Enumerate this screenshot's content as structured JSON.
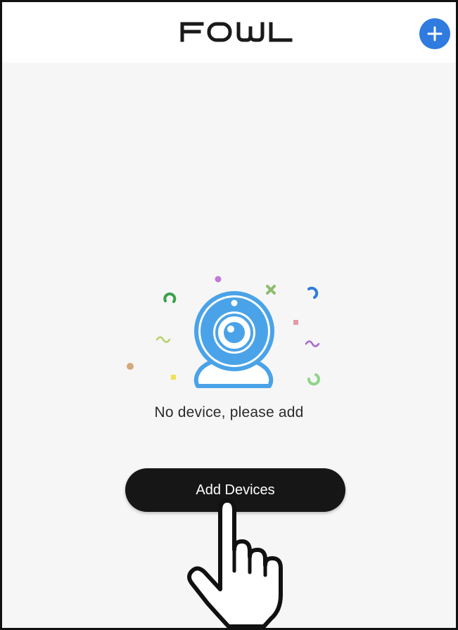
{
  "header": {
    "logo_text": "FOWL",
    "add_button_label": "+"
  },
  "empty_state": {
    "illustration_icon": "webcam-icon",
    "message": "No device, please add"
  },
  "main": {
    "add_devices_label": "Add Devices"
  },
  "overlay": {
    "pointer_icon": "hand-pointer-icon"
  },
  "colors": {
    "accent": "#2f7be0",
    "camera_blue": "#4aa3e8",
    "button_bg": "#161616",
    "page_bg": "#f6f6f6"
  }
}
